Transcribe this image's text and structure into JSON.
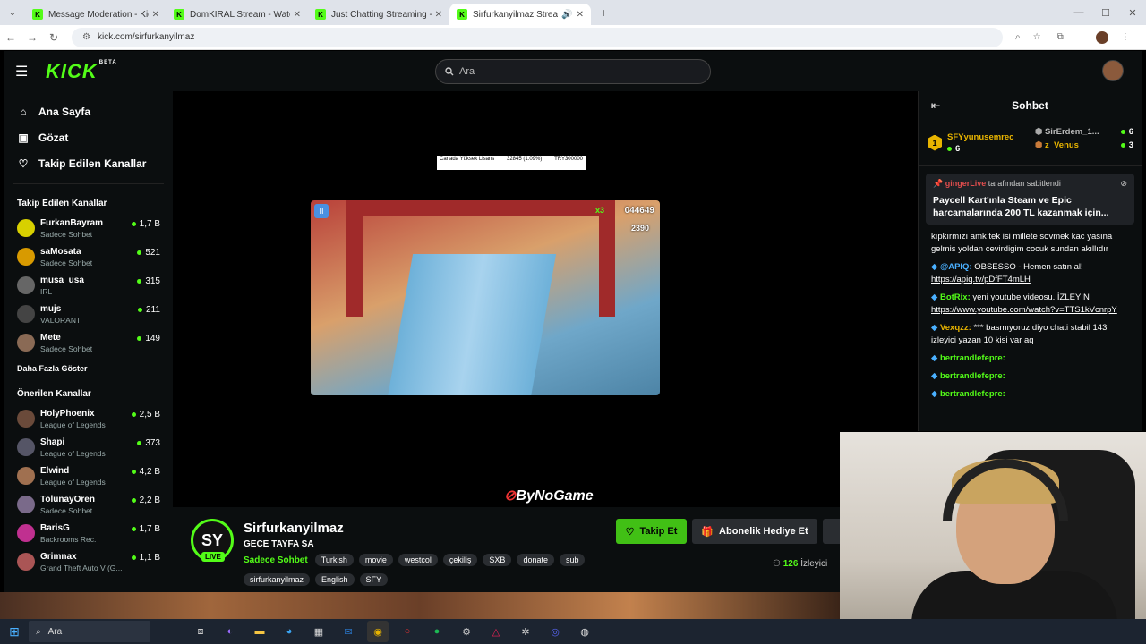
{
  "browser": {
    "tabs": [
      {
        "title": "Message Moderation - Kick Da",
        "active": false
      },
      {
        "title": "DomKIRAL Stream - Watch Live",
        "active": false
      },
      {
        "title": "Just Chatting Streaming - Live S",
        "active": false
      },
      {
        "title": "Sirfurkanyilmaz Stream - W",
        "active": true
      }
    ],
    "url": "kick.com/sirfurkanyilmaz"
  },
  "header": {
    "logo": "KICK",
    "logo_tag": "BETA",
    "search_placeholder": "Ara"
  },
  "sidebar": {
    "nav": [
      {
        "label": "Ana Sayfa",
        "icon": "home-icon"
      },
      {
        "label": "Gözat",
        "icon": "browse-icon"
      },
      {
        "label": "Takip Edilen Kanallar",
        "icon": "heart-icon"
      }
    ],
    "followed_title": "Takip Edilen Kanallar",
    "followed": [
      {
        "name": "FurkanBayram",
        "sub": "Sadece Sohbet",
        "count": "1,7 B",
        "color": "#d8d000"
      },
      {
        "name": "saMosata",
        "sub": "Sadece Sohbet",
        "count": "521",
        "color": "#d89a00"
      },
      {
        "name": "musa_usa",
        "sub": "IRL",
        "count": "315",
        "color": "#666"
      },
      {
        "name": "mujs",
        "sub": "VALORANT",
        "count": "211",
        "color": "#444"
      },
      {
        "name": "Mete",
        "sub": "Sadece Sohbet",
        "count": "149",
        "color": "#8a6a55"
      }
    ],
    "more_label": "Daha Fazla Göster",
    "recommended_title": "Önerilen Kanallar",
    "recommended": [
      {
        "name": "HolyPhoenix",
        "sub": "League of Legends",
        "count": "2,5 B",
        "color": "#6a4a3a"
      },
      {
        "name": "Shapi",
        "sub": "League of Legends",
        "count": "373",
        "color": "#556"
      },
      {
        "name": "Elwind",
        "sub": "League of Legends",
        "count": "4,2 B",
        "color": "#a07050"
      },
      {
        "name": "TolunayOren",
        "sub": "Sadece Sohbet",
        "count": "2,2 B",
        "color": "#7a6a8a"
      },
      {
        "name": "BarisG",
        "sub": "Backrooms Rec.",
        "count": "1,7 B",
        "color": "#c03090"
      },
      {
        "name": "Grimnax",
        "sub": "Grand Theft Auto V (G...",
        "count": "1,1 B",
        "color": "#aa5555"
      }
    ]
  },
  "player": {
    "ticker": [
      "Canada Yüksek Lisans",
      "32845 (1.09%)",
      "TRY300000"
    ],
    "score": "044649",
    "multiplier": "x3",
    "coins": "2390",
    "watermark": "ByNoGame"
  },
  "stream": {
    "avatar_text": "SY",
    "live_label": "LIVE",
    "name": "Sirfurkanyilmaz",
    "title": "GECE TAYFA SA",
    "category": "Sadece Sohbet",
    "tags": [
      "Turkish",
      "movie",
      "westcol",
      "çekiliş",
      "SXB",
      "donate",
      "sub"
    ],
    "tags2": [
      "sirfurkanyilmaz",
      "English",
      "SFY"
    ],
    "follow_label": "Takip Et",
    "gift_label": "Abonelik Hediye Et",
    "viewers": "126",
    "viewers_label": "İzleyici"
  },
  "chat": {
    "title": "Sohbet",
    "gifters": [
      {
        "name": "SFYyunusemrec",
        "count": "6",
        "rank": "1"
      },
      {
        "name": "SirErdem_1...",
        "count": "6"
      },
      {
        "name": "z_Venus",
        "count": "3"
      }
    ],
    "pinned_by": "gingerLive",
    "pinned_suffix": "tarafından sabitlendi",
    "pinned_text": "Paycell Kart'ınla Steam ve Epic harcamalarında 200 TL kazanmak için...",
    "messages": [
      {
        "user": "",
        "text": "kıpkırmızı amk tek isi millete sovmek kac yasına gelmis yoldan cevirdigim cocuk sundan akıllıdır",
        "color": "#fff"
      },
      {
        "user": "@APIQ:",
        "text": "OBSESSO - Hemen satın al!",
        "link": "https://apiq.tv/pDfFT4mLH",
        "color": "#4ab0ff"
      },
      {
        "user": "BotRix:",
        "text": "yeni youtube videosu. İZLEYİN",
        "link": "https://www.youtube.com/watch?v=TTS1kVcnrpY",
        "color": "#53fc18"
      },
      {
        "user": "Vexqzz:",
        "text": "*** basmıyoruz diyo chati stabil 143 izleyici yazan 10 kisi var aq",
        "color": "#e8b400"
      },
      {
        "user": "bertrandlefepre:",
        "text": "",
        "color": "#53fc18"
      },
      {
        "user": "bertrandlefepre:",
        "text": "",
        "color": "#53fc18"
      },
      {
        "user": "bertrandlefepre:",
        "text": "",
        "color": "#53fc18"
      }
    ]
  },
  "taskbar": {
    "search_placeholder": "Ara"
  }
}
